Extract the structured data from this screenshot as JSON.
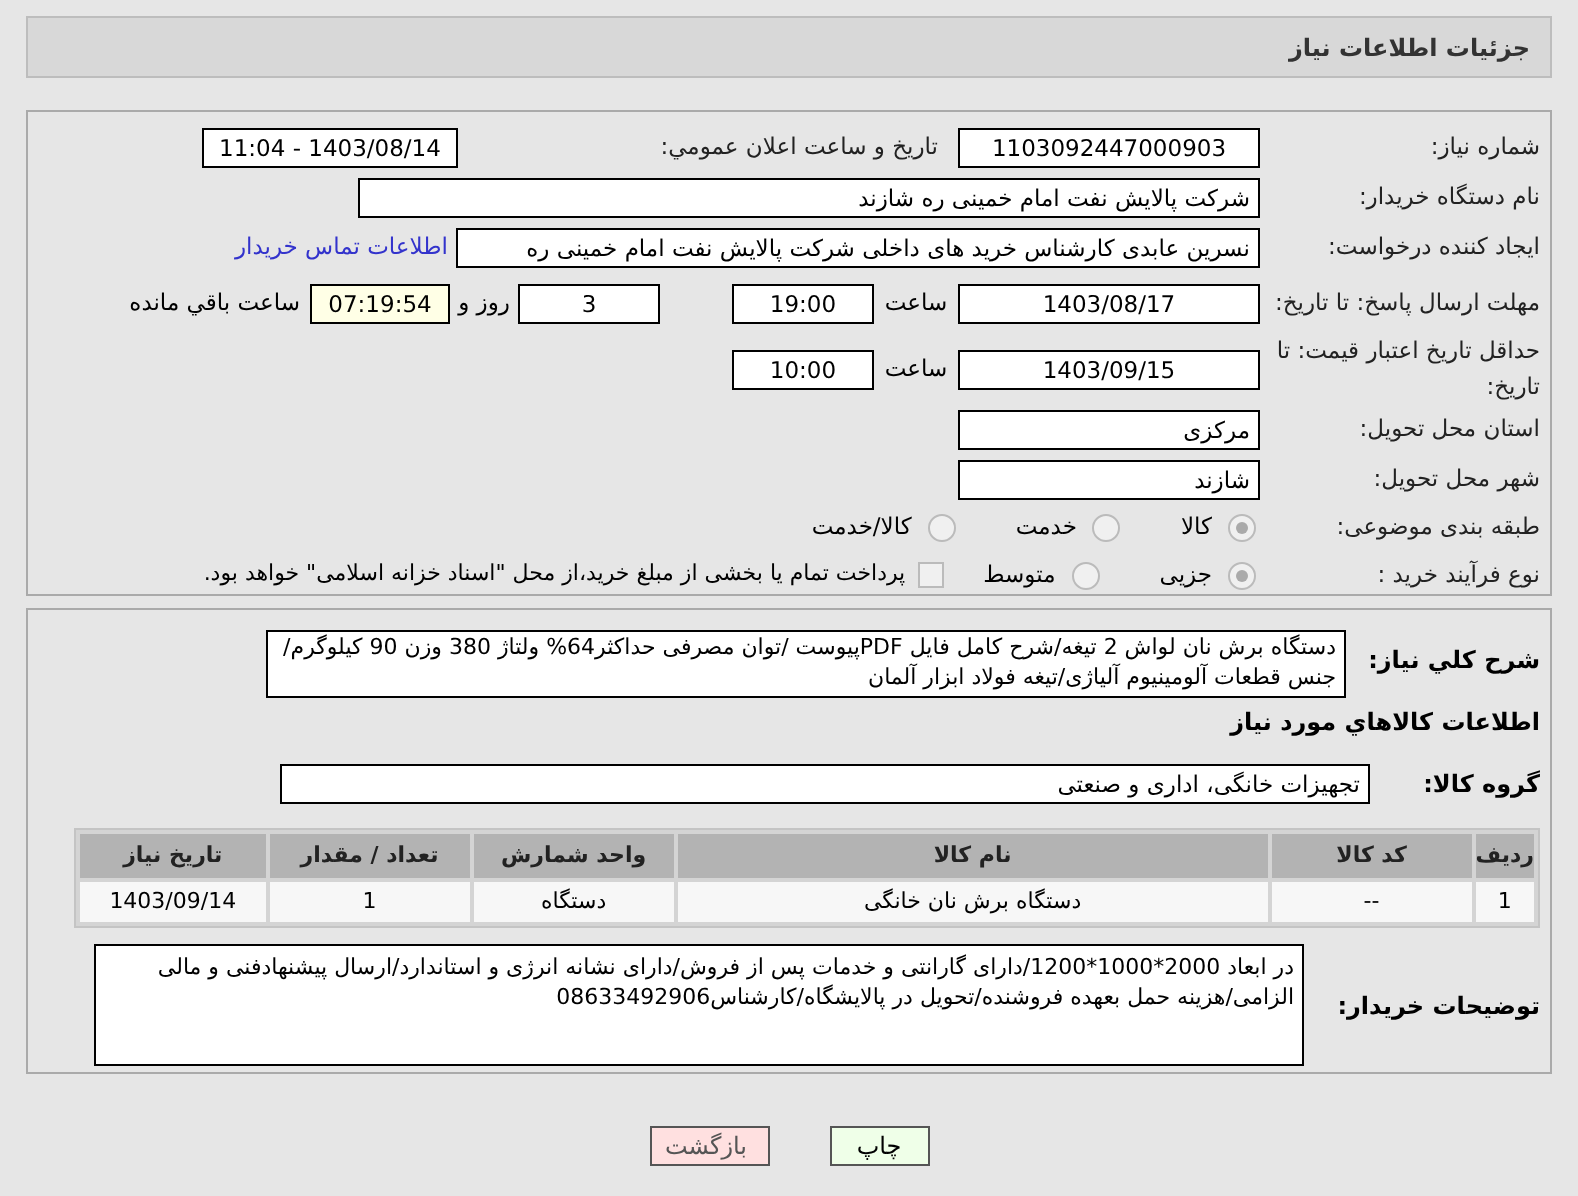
{
  "header": {
    "title": "جزئیات اطلاعات نیاز"
  },
  "details": {
    "need_number": {
      "label": "شماره نیاز:",
      "value": "1103092447000903"
    },
    "announce": {
      "label": "تاریخ و ساعت اعلان عمومي:",
      "value": "1403/08/14 - 11:04"
    },
    "buyer": {
      "label": "نام دستگاه خریدار:",
      "value": "شرکت پالایش نفت امام خمینی  ره  شازند"
    },
    "creator": {
      "label": "ایجاد کننده درخواست:",
      "value": "نسرین عابدی کارشناس خرید های داخلی  شرکت پالایش نفت امام خمینی  ره",
      "link": "اطلاعات تماس خریدار"
    },
    "deadline": {
      "label": "مهلت ارسال پاسخ: تا تاریخ:",
      "date": "1403/08/17",
      "time_label": "ساعت",
      "time": "19:00",
      "days": "3",
      "days_label": "روز و",
      "remaining": "07:19:54",
      "remaining_label": "ساعت باقي مانده"
    },
    "validity": {
      "label": "حداقل تاریخ اعتبار قیمت: تا تاریخ:",
      "date": "1403/09/15",
      "time_label": "ساعت",
      "time": "10:00"
    },
    "province": {
      "label": "استان محل تحویل:",
      "value": "مرکزی"
    },
    "city": {
      "label": "شهر محل تحویل:",
      "value": "شازند"
    },
    "category": {
      "label": "طبقه بندی موضوعی:",
      "disabled": true,
      "options": [
        {
          "label": "کالا",
          "selected": true
        },
        {
          "label": "خدمت",
          "selected": false
        },
        {
          "label": "کالا/خدمت",
          "selected": false
        }
      ]
    },
    "process": {
      "label": "نوع فرآیند خرید :",
      "disabled": true,
      "options": [
        {
          "label": "جزیی",
          "selected": true
        },
        {
          "label": "متوسط",
          "selected": false
        }
      ],
      "treasury": {
        "label": "پرداخت تمام یا بخشی از مبلغ خرید،از محل \"اسناد خزانه اسلامی\" خواهد بود.",
        "checked": false
      }
    }
  },
  "needs": {
    "summary": {
      "label": "شرح کلي نیاز:",
      "value": "دستگاه برش نان لواش 2 تیغه/شرح کامل فایل PDFپیوست /توان مصرفی حداکثر64% ولتاژ 380 وزن 90 کیلوگرم/جنس قطعات آلومینیوم آلیاژی/تیغه فولاد ابزار آلمان"
    },
    "goods_heading": "اطلاعات کالاهاي مورد نیاز",
    "group": {
      "label": "گروه کالا:",
      "value": "تجهیزات خانگی، اداری و صنعتی"
    },
    "table": {
      "columns": [
        "ردیف",
        "کد کالا",
        "نام کالا",
        "واحد شمارش",
        "تعداد / مقدار",
        "تاریخ نیاز"
      ],
      "rows": [
        [
          "1",
          "--",
          "دستگاه برش نان خانگی",
          "دستگاه",
          "1",
          "1403/09/14"
        ]
      ]
    },
    "notes": {
      "label": "توضیحات خریدار:",
      "value": "در ابعاد 2000*1000*1200/دارای گارانتی و خدمات پس از فروش/دارای نشانه انرژی و استاندارد/ارسال پیشنهادفنی و مالی الزامی/هزینه حمل بعهده فروشنده/تحویل در پالایشگاه/کارشناس08633492906"
    }
  },
  "buttons": [
    {
      "label": "چاپ",
      "kind": "print"
    },
    {
      "label": "بازگشت",
      "kind": "back"
    }
  ]
}
